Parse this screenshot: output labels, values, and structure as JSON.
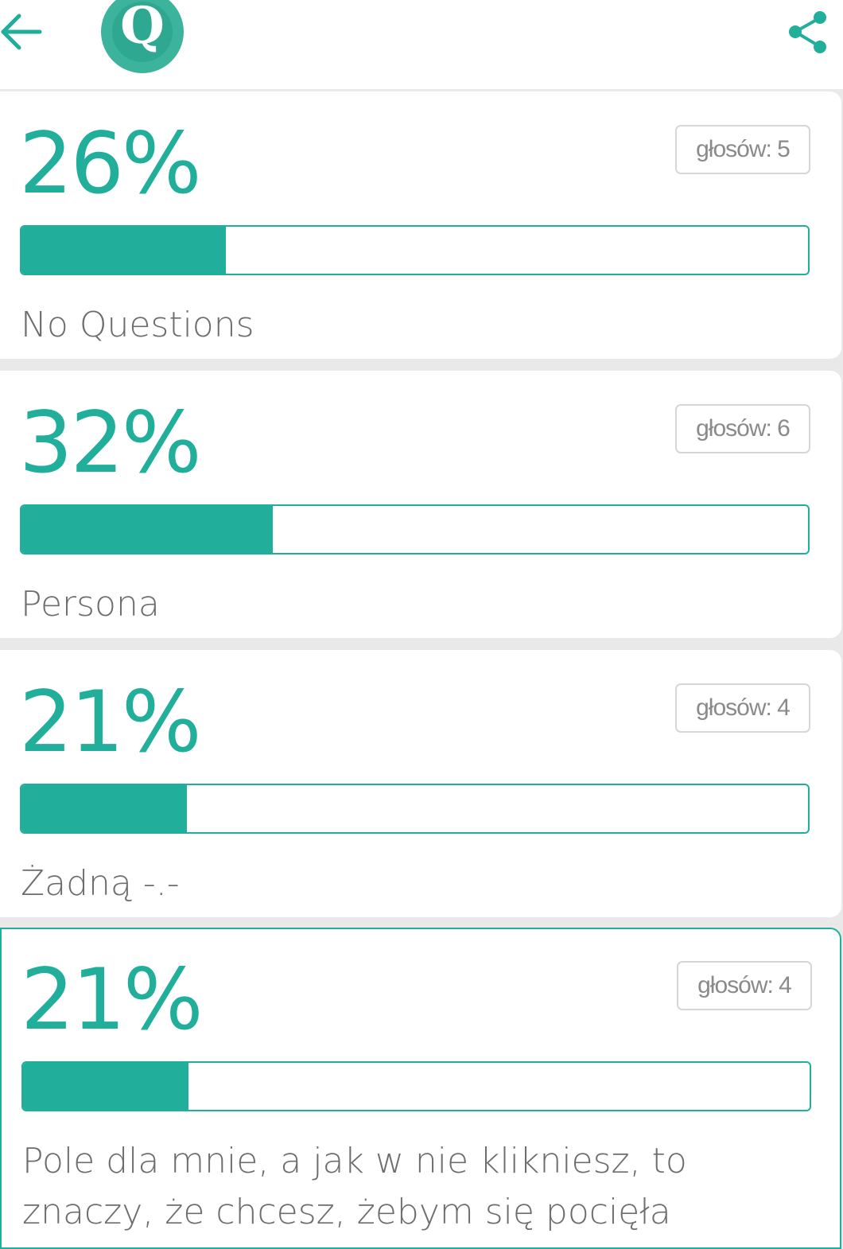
{
  "header": {
    "back_icon": "arrow-left-icon",
    "logo_letter": "Q",
    "share_icon": "share-icon",
    "accent_color": "#21ae9a"
  },
  "options": [
    {
      "percent_label": "26%",
      "percent": 26,
      "votes_label": "głosów: 5",
      "label": "No Questions",
      "selected": false
    },
    {
      "percent_label": "32%",
      "percent": 32,
      "votes_label": "głosów: 6",
      "label": "Persona",
      "selected": false
    },
    {
      "percent_label": "21%",
      "percent": 21,
      "votes_label": "głosów: 4",
      "label": "Żadną -.-",
      "selected": false
    },
    {
      "percent_label": "21%",
      "percent": 21,
      "votes_label": "głosów: 4",
      "label": "Pole dla mnie, a jak w nie klikniesz, to znaczy, że chcesz, żebym się pocięła",
      "selected": true
    }
  ]
}
